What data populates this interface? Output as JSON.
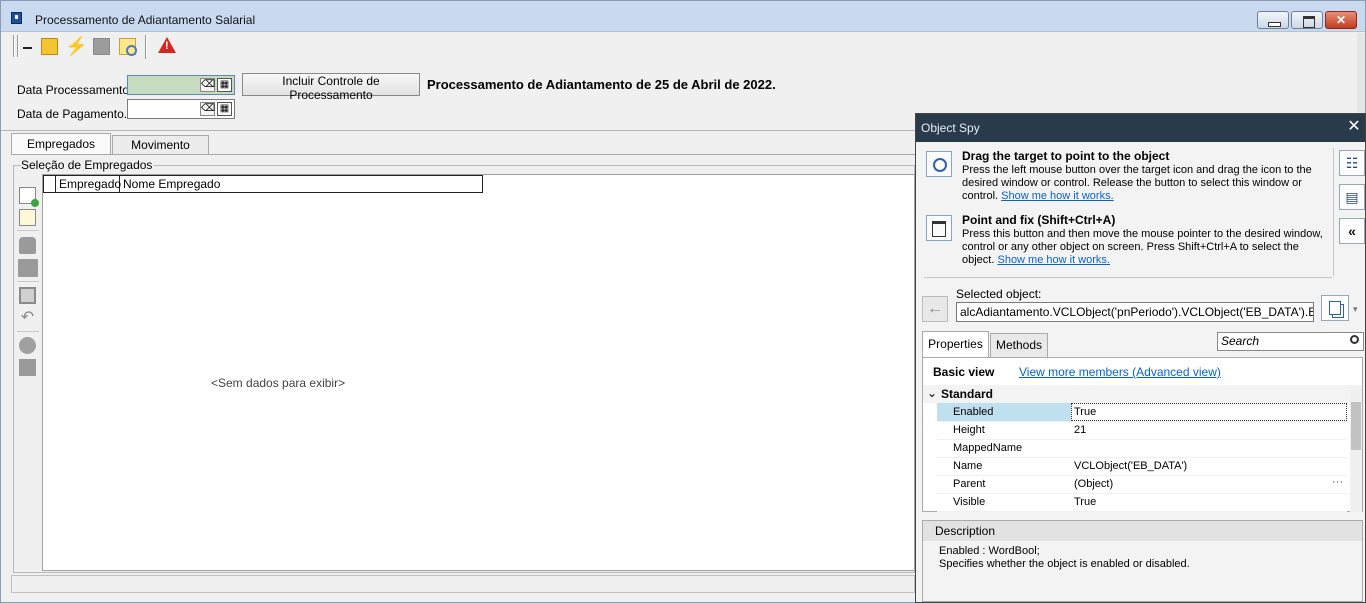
{
  "main_window": {
    "title": "Processamento de Adiantamento Salarial",
    "icons": {
      "minus": "minus-icon",
      "book": "book-icon",
      "bolt": "lightning-icon",
      "stop": "stop-icon",
      "search": "search-doc-icon",
      "warning": "warning-icon"
    },
    "bolt_glyph": "⚡",
    "fields": {
      "data_processamento_label": "Data Processamento...",
      "data_pagamento_label": "Data de Pagamento....",
      "data_processamento_value": "",
      "data_pagamento_value": ""
    },
    "incluir_button": "Incluir Controle de Processamento",
    "process_title": "Processamento de Adiantamento de 25 de Abril de 2022.",
    "tabs": [
      "Empregados",
      "Movimento"
    ],
    "group_label": "Seleção de Empregados",
    "grid": {
      "columns": [
        "Empregado",
        "Nome Empregado"
      ],
      "empty_text": "<Sem dados para exibir>"
    },
    "undo_glyph": "↶"
  },
  "object_spy": {
    "title": "Object Spy",
    "close_glyph": "✕",
    "instructions": [
      {
        "title": "Drag the target to point to the object",
        "text": "Press the left mouse button over the target icon and drag the icon to the desired window or control. Release the button to select this window or control.",
        "link": "Show me how it works."
      },
      {
        "title": "Point and fix (Shift+Ctrl+A)",
        "text": "Press this button and then move the mouse pointer to the desired window, control or any other object on screen. Press Shift+Ctrl+A to select the object.",
        "link": "Show me how it works."
      }
    ],
    "side_glyphs": {
      "tree": "☷",
      "db": "▤",
      "collapse": "«"
    },
    "back_glyph": "←",
    "copy_arrow": "▾",
    "selected_label": "Selected object:",
    "selected_value": "alcAdiantamento.VCLObject('pnPeriodo').VCLObject('EB_DATA').Enabled",
    "tabs": [
      "Properties",
      "Methods"
    ],
    "search_placeholder": "Search",
    "basic_view": "Basic view",
    "advanced_link": "View more members (Advanced view)",
    "section": "Standard",
    "section_chevron": "⌄",
    "properties": [
      {
        "name": "Enabled",
        "value": "True"
      },
      {
        "name": "Height",
        "value": "21"
      },
      {
        "name": "MappedName",
        "value": ""
      },
      {
        "name": "Name",
        "value": "VCLObject('EB_DATA')"
      },
      {
        "name": "Parent",
        "value": "(Object)"
      },
      {
        "name": "Visible",
        "value": "True"
      }
    ],
    "ellipsis": "···",
    "description": {
      "header": "Description",
      "line1": "Enabled : WordBool;",
      "line2": "Specifies whether the object is enabled or disabled."
    }
  }
}
